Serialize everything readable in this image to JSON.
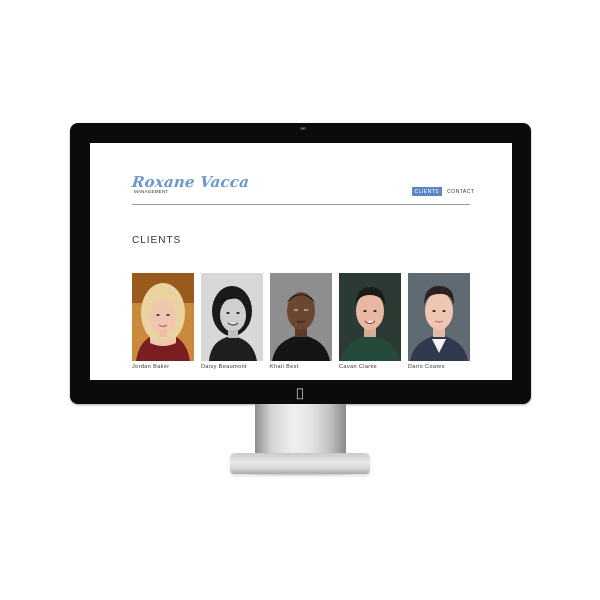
{
  "site": {
    "logo_text": "Roxane Vacca",
    "logo_subtitle": "MANAGEMENT",
    "accent_color": "#5d87bf"
  },
  "nav": {
    "items": [
      {
        "label": "CLIENTS",
        "active": true
      },
      {
        "label": "CONTACT",
        "active": false
      }
    ]
  },
  "main": {
    "heading": "CLIENTS",
    "clients": [
      {
        "name": "Jordan Baker"
      },
      {
        "name": "Daisy Beaumont"
      },
      {
        "name": "Khali Best"
      },
      {
        "name": "Cavan Clarke"
      },
      {
        "name": "Dario Coates"
      }
    ]
  },
  "hardware": {
    "logo_icon": "apple-logo-icon",
    "camera_icon": "camera-icon"
  }
}
